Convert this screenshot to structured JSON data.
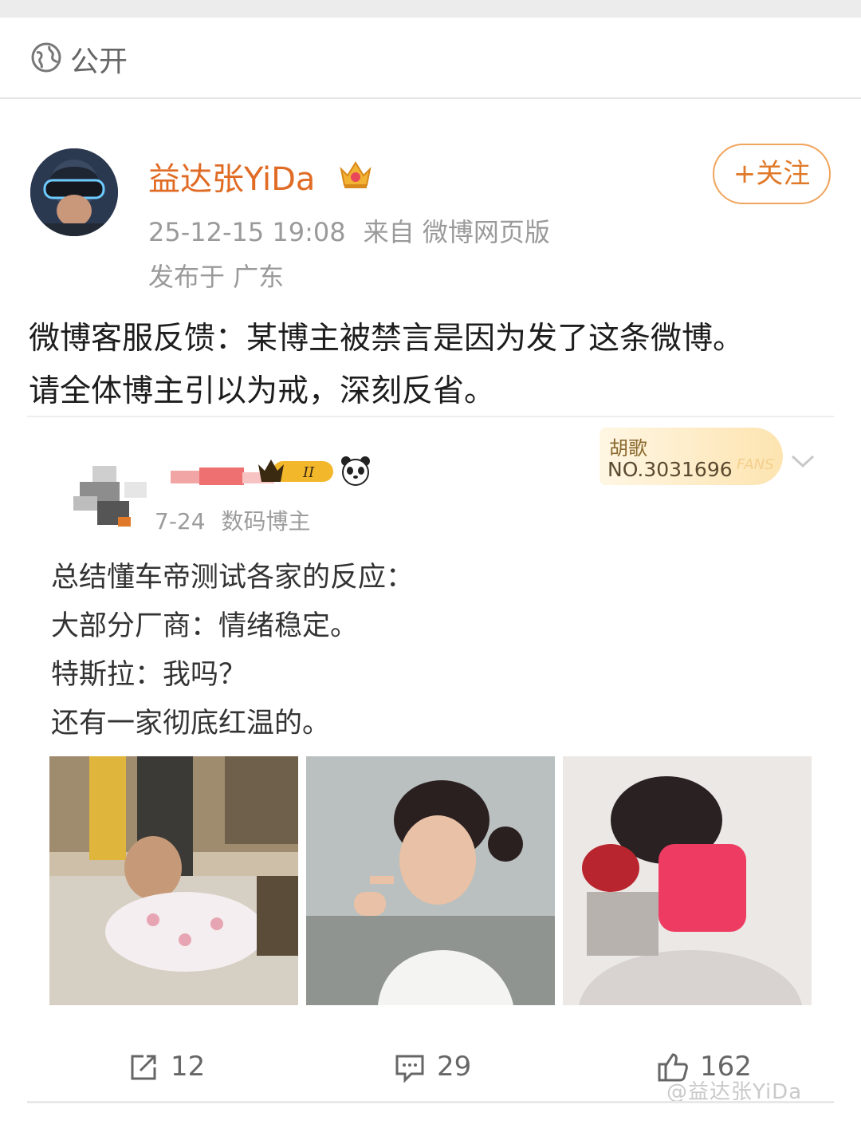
{
  "header": {
    "visibility_label": "公开",
    "visibility_icon": "globe-icon"
  },
  "post": {
    "author": "益达张YiDa",
    "verified_icon": "crown-icon",
    "follow_label": "+关注",
    "timestamp": "25-12-15 19:08",
    "source": "来自 微博网页版",
    "location": "发布于 广东",
    "text_lines": [
      "微博客服反馈：某博主被禁言是因为发了这条微博。",
      "请全体博主引以为戒，深刻反省。"
    ]
  },
  "embedded": {
    "date": "7-24",
    "role": "数码博主",
    "fans_card": {
      "name": "胡歌",
      "number": "NO.3031696",
      "tag": "FANS"
    },
    "text_lines": [
      "总结懂车帝测试各家的反应：",
      "大部分厂商：情绪稳定。",
      "特斯拉：我吗？",
      "还有一家彻底红温的。"
    ]
  },
  "actions": {
    "repost_count": "12",
    "comment_count": "29",
    "like_count": "162"
  },
  "watermark": "@益达张YiDa",
  "colors": {
    "accent": "#e06b25",
    "follow_border": "#f0a45c",
    "meta": "#9a9a9a"
  }
}
